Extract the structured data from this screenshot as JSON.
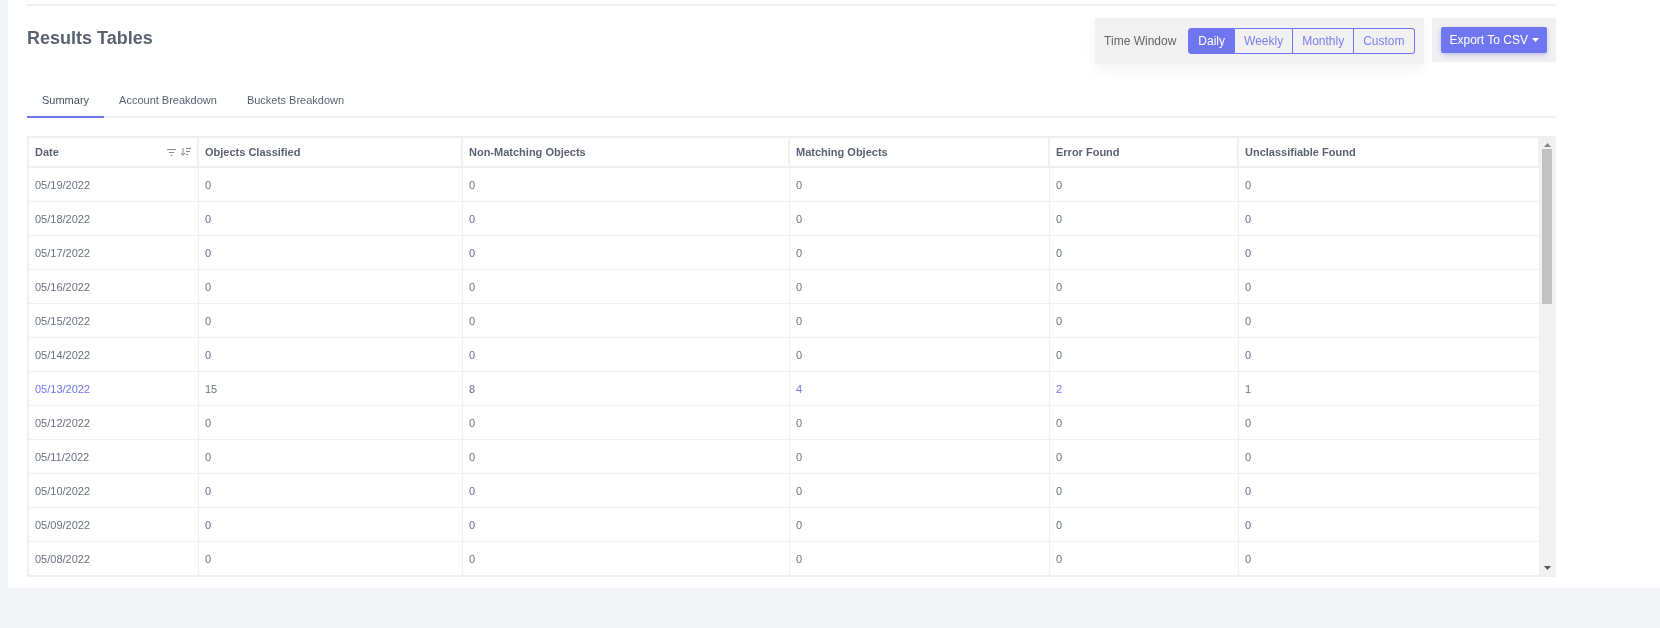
{
  "title": "Results Tables",
  "time_window": {
    "label": "Time Window",
    "options": [
      {
        "label": "Daily",
        "selected": true
      },
      {
        "label": "Weekly",
        "selected": false
      },
      {
        "label": "Monthly",
        "selected": false
      },
      {
        "label": "Custom",
        "selected": false
      }
    ]
  },
  "export_button": {
    "label": "Export To CSV"
  },
  "tabs": [
    {
      "label": "Summary",
      "selected": true
    },
    {
      "label": "Account Breakdown",
      "selected": false
    },
    {
      "label": "Buckets Breakdown",
      "selected": false
    }
  ],
  "table": {
    "columns": [
      "Date",
      "Objects Classified",
      "Non-Matching Objects",
      "Matching Objects",
      "Error Found",
      "Unclassifiable Found"
    ],
    "rows": [
      {
        "cells": [
          {
            "text": "05/19/2022",
            "link": false
          },
          {
            "text": "0",
            "link": false
          },
          {
            "text": "0",
            "link": false
          },
          {
            "text": "0",
            "link": false
          },
          {
            "text": "0",
            "link": false
          },
          {
            "text": "0",
            "link": false
          }
        ]
      },
      {
        "cells": [
          {
            "text": "05/18/2022",
            "link": false
          },
          {
            "text": "0",
            "link": false
          },
          {
            "text": "0",
            "link": false
          },
          {
            "text": "0",
            "link": false
          },
          {
            "text": "0",
            "link": false
          },
          {
            "text": "0",
            "link": false
          }
        ]
      },
      {
        "cells": [
          {
            "text": "05/17/2022",
            "link": false
          },
          {
            "text": "0",
            "link": false
          },
          {
            "text": "0",
            "link": false
          },
          {
            "text": "0",
            "link": false
          },
          {
            "text": "0",
            "link": false
          },
          {
            "text": "0",
            "link": false
          }
        ]
      },
      {
        "cells": [
          {
            "text": "05/16/2022",
            "link": false
          },
          {
            "text": "0",
            "link": false
          },
          {
            "text": "0",
            "link": false
          },
          {
            "text": "0",
            "link": false
          },
          {
            "text": "0",
            "link": false
          },
          {
            "text": "0",
            "link": false
          }
        ]
      },
      {
        "cells": [
          {
            "text": "05/15/2022",
            "link": false
          },
          {
            "text": "0",
            "link": false
          },
          {
            "text": "0",
            "link": false
          },
          {
            "text": "0",
            "link": false
          },
          {
            "text": "0",
            "link": false
          },
          {
            "text": "0",
            "link": false
          }
        ]
      },
      {
        "cells": [
          {
            "text": "05/14/2022",
            "link": false
          },
          {
            "text": "0",
            "link": false
          },
          {
            "text": "0",
            "link": false
          },
          {
            "text": "0",
            "link": false
          },
          {
            "text": "0",
            "link": false
          },
          {
            "text": "0",
            "link": false
          }
        ]
      },
      {
        "cells": [
          {
            "text": "05/13/2022",
            "link": true
          },
          {
            "text": "15",
            "link": false
          },
          {
            "text": "8",
            "link": false
          },
          {
            "text": "4",
            "link": true
          },
          {
            "text": "2",
            "link": true
          },
          {
            "text": "1",
            "link": false
          }
        ]
      },
      {
        "cells": [
          {
            "text": "05/12/2022",
            "link": false
          },
          {
            "text": "0",
            "link": false
          },
          {
            "text": "0",
            "link": false
          },
          {
            "text": "0",
            "link": false
          },
          {
            "text": "0",
            "link": false
          },
          {
            "text": "0",
            "link": false
          }
        ]
      },
      {
        "cells": [
          {
            "text": "05/11/2022",
            "link": false
          },
          {
            "text": "0",
            "link": false
          },
          {
            "text": "0",
            "link": false
          },
          {
            "text": "0",
            "link": false
          },
          {
            "text": "0",
            "link": false
          },
          {
            "text": "0",
            "link": false
          }
        ]
      },
      {
        "cells": [
          {
            "text": "05/10/2022",
            "link": false
          },
          {
            "text": "0",
            "link": false
          },
          {
            "text": "0",
            "link": false
          },
          {
            "text": "0",
            "link": false
          },
          {
            "text": "0",
            "link": false
          },
          {
            "text": "0",
            "link": false
          }
        ]
      },
      {
        "cells": [
          {
            "text": "05/09/2022",
            "link": false
          },
          {
            "text": "0",
            "link": false
          },
          {
            "text": "0",
            "link": false
          },
          {
            "text": "0",
            "link": false
          },
          {
            "text": "0",
            "link": false
          },
          {
            "text": "0",
            "link": false
          }
        ]
      },
      {
        "cells": [
          {
            "text": "05/08/2022",
            "link": false
          },
          {
            "text": "0",
            "link": false
          },
          {
            "text": "0",
            "link": false
          },
          {
            "text": "0",
            "link": false
          },
          {
            "text": "0",
            "link": false
          },
          {
            "text": "0",
            "link": false
          }
        ]
      }
    ]
  }
}
